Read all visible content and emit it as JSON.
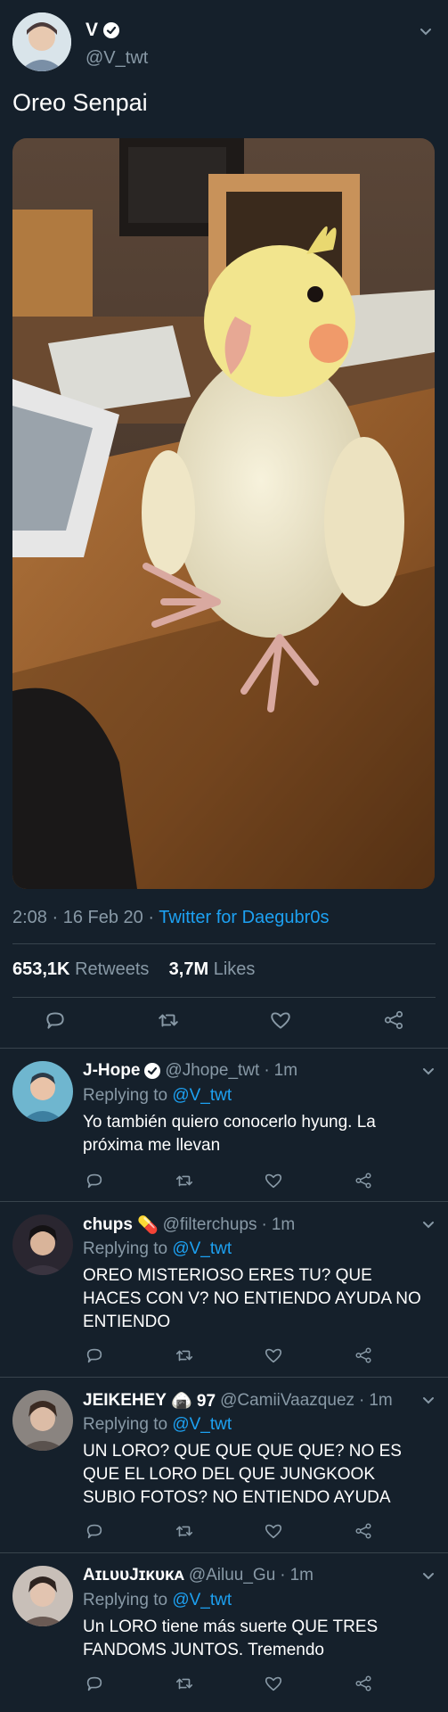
{
  "main_tweet": {
    "author_name": "V",
    "author_handle": "@V_twt",
    "text": "Oreo Senpai",
    "time": "2:08",
    "date": "16 Feb 20",
    "source": "Twitter for Daegubr0s",
    "retweets_count": "653,1K",
    "retweets_label": "Retweets",
    "likes_count": "3,7M",
    "likes_label": "Likes"
  },
  "replies": [
    {
      "name": "J-Hope",
      "emoji": "",
      "handle": "@Jhope_twt",
      "time": "1m",
      "replying_label": "Replying to",
      "replying_to": "@V_twt",
      "text": "Yo también quiero conocerlo hyung. La próxima me llevan"
    },
    {
      "name": "chups",
      "emoji": "💊",
      "handle": "@filterchups",
      "time": "1m",
      "replying_label": "Replying to",
      "replying_to": "@V_twt",
      "text": "OREO MISTERIOSO ERES TU? QUE HACES CON V? NO ENTIENDO AYUDA NO ENTIENDO"
    },
    {
      "name": "JEIKEHEY",
      "emoji": "🍙 97",
      "handle": "@CamiiVaazquez",
      "time": "1m",
      "replying_label": "Replying to",
      "replying_to": "@V_twt",
      "text": "UN LORO? QUE QUE QUE QUE? NO ES QUE EL LORO DEL QUE JUNGKOOK SUBIO FOTOS? NO ENTIENDO AYUDA"
    },
    {
      "name": "AɪʟᴜᴜJɪᴋᴜᴋᴀ",
      "emoji": "",
      "handle": "@Ailuu_Gu",
      "time": "1m",
      "replying_label": "Replying to",
      "replying_to": "@V_twt",
      "text": "Un LORO tiene más suerte QUE TRES FANDOMS JUNTOS. Tremendo"
    }
  ],
  "separator": "·",
  "icons": {
    "reply": "reply-icon",
    "retweet": "retweet-icon",
    "like": "heart-icon",
    "share": "share-icon",
    "verified": "verified-badge-icon",
    "caret": "chevron-down-icon"
  },
  "colors": {
    "background": "#15202b",
    "accent": "#1da1f2",
    "muted": "#8899a6",
    "divider": "#38444d"
  }
}
